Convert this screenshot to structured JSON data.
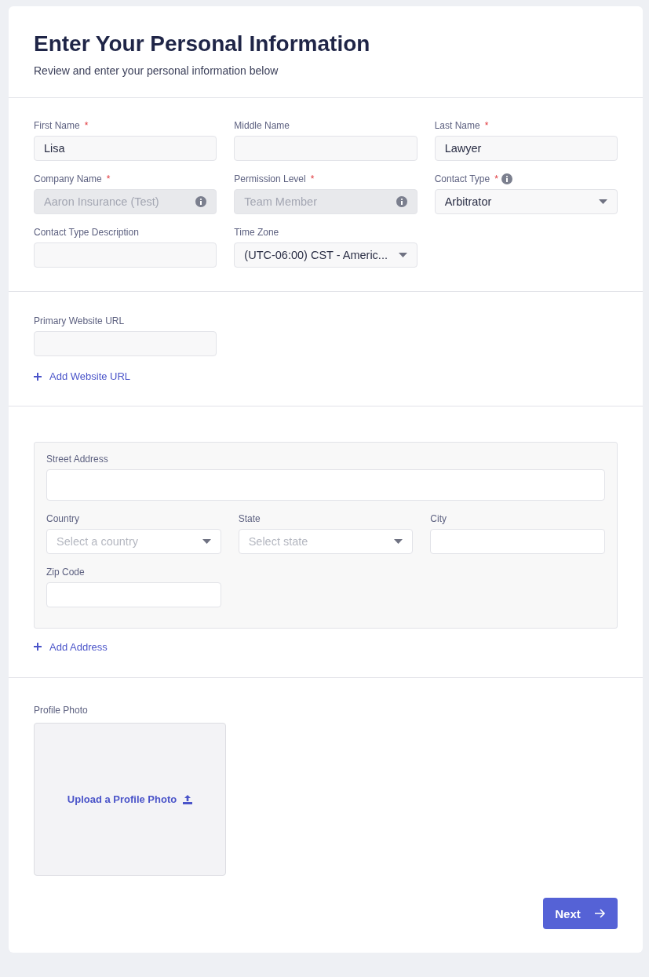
{
  "header": {
    "title": "Enter Your Personal Information",
    "subtitle": "Review and enter your personal information below"
  },
  "personal_fields": [
    {
      "label": "First Name",
      "required_mark": "*",
      "kind": "input",
      "disabled": false,
      "label_info": false,
      "field_info": false,
      "value": "Lisa"
    },
    {
      "label": "Middle Name",
      "kind": "input",
      "disabled": false,
      "label_info": false,
      "field_info": false
    },
    {
      "label": "Last Name",
      "required_mark": "*",
      "kind": "input",
      "disabled": false,
      "label_info": false,
      "field_info": false,
      "value": "Lawyer"
    },
    {
      "label": "Company Name",
      "required_mark": "*",
      "kind": "input",
      "disabled": true,
      "label_info": false,
      "field_info": true,
      "value": "Aaron Insurance (Test)"
    },
    {
      "label": "Permission Level",
      "required_mark": "*",
      "kind": "input",
      "disabled": true,
      "label_info": false,
      "field_info": true,
      "value": "Team Member"
    },
    {
      "label": "Contact Type",
      "required_mark": "*",
      "kind": "select",
      "disabled": false,
      "label_info": true,
      "field_info": false,
      "value": "Arbitrator"
    },
    {
      "label": "Contact Type Description",
      "kind": "input",
      "disabled": false,
      "label_info": false,
      "field_info": false
    },
    {
      "label": "Time Zone",
      "kind": "select",
      "disabled": false,
      "label_info": false,
      "field_info": false,
      "value": "(UTC-06:00) CST - Americ..."
    }
  ],
  "website": {
    "label": "Primary Website URL",
    "add_link": "Add Website URL"
  },
  "address": {
    "street": {
      "label": "Street Address"
    },
    "fields": [
      {
        "label": "Country",
        "kind": "select",
        "placeholder": "Select a country"
      },
      {
        "label": "State",
        "kind": "select",
        "placeholder": "Select state"
      },
      {
        "label": "City",
        "kind": "input"
      },
      {
        "label": "Zip Code",
        "kind": "input"
      }
    ],
    "add_link": "Add Address"
  },
  "photo": {
    "label": "Profile Photo",
    "upload": "Upload a Profile Photo"
  },
  "next_button": "Next"
}
